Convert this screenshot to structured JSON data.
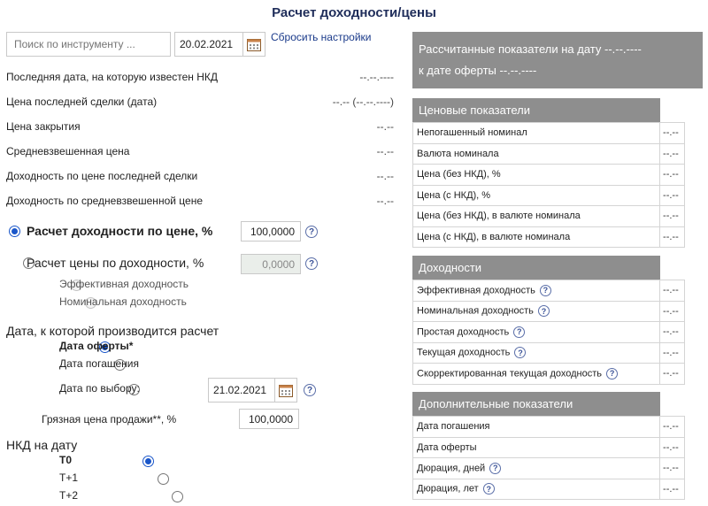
{
  "page": {
    "title": "Расчет доходности/цены"
  },
  "toolbar": {
    "search_placeholder": "Поиск по инструменту ...",
    "date": "20.02.2021",
    "reset_label": "Сбросить настройки"
  },
  "info": {
    "rows": [
      {
        "label": "Последняя дата, на которую известен НКД",
        "value": "--.--.----"
      },
      {
        "label": "Цена последней сделки (дата)",
        "value": "--.-- (--.--.----)"
      },
      {
        "label": "Цена закрытия",
        "value": "--.--"
      },
      {
        "label": "Средневзвешенная цена",
        "value": "--.--"
      },
      {
        "label": "Доходность по цене последней сделки",
        "value": "--.--"
      },
      {
        "label": "Доходность по средневзвешенной цене",
        "value": "--.--"
      }
    ]
  },
  "calc": {
    "by_price_label": "Расчет доходности по цене, %",
    "by_price_value": "100,0000",
    "by_yield_label": "Расчет цены по доходности, %",
    "by_yield_value": "0,0000",
    "yield_options": [
      "Эффективная доходность",
      "Номинальная доходность"
    ]
  },
  "calc_date": {
    "label": "Дата, к которой производится расчет",
    "options": [
      "Дата оферты*",
      "Дата погашения",
      "Дата по выбору:"
    ],
    "custom_date": "21.02.2021",
    "dirty_price_label": "Грязная цена продажи**, %",
    "dirty_price_value": "100,0000"
  },
  "nkd": {
    "label": "НКД на дату",
    "options": [
      "Т0",
      "Т+1",
      "Т+2"
    ]
  },
  "right": {
    "header_line1": "Рассчитанные показатели на дату --.--.----",
    "header_line2": "к дате оферты --.--.----",
    "price_section": {
      "title": "Ценовые показатели",
      "rows": [
        {
          "label": "Непогашенный номинал",
          "value": "--.--"
        },
        {
          "label": "Валюта номинала",
          "value": "--.--"
        },
        {
          "label": "Цена (без НКД), %",
          "value": "--.--"
        },
        {
          "label": "Цена (с НКД), %",
          "value": "--.--"
        },
        {
          "label": "Цена (без НКД), в валюте номинала",
          "value": "--.--"
        },
        {
          "label": "Цена (с НКД), в валюте номинала",
          "value": "--.--"
        }
      ]
    },
    "yield_section": {
      "title": "Доходности",
      "rows": [
        {
          "label": "Эффективная доходность",
          "value": "--.--"
        },
        {
          "label": "Номинальная доходность",
          "value": "--.--"
        },
        {
          "label": "Простая доходность",
          "value": "--.--"
        },
        {
          "label": "Текущая доходность",
          "value": "--.--"
        },
        {
          "label": "Скорректированная текущая доходность",
          "value": "--.--"
        }
      ]
    },
    "extra_section": {
      "title": "Дополнительные показатели",
      "rows": [
        {
          "label": "Дата погашения",
          "value": "--.--"
        },
        {
          "label": "Дата оферты",
          "value": "--.--"
        },
        {
          "label": "Дюрация, дней",
          "value": "--.--"
        },
        {
          "label": "Дюрация, лет",
          "value": "--.--"
        }
      ]
    }
  },
  "colors": {
    "accent": "#1a56c9",
    "header_bg": "#8e8e8e",
    "title": "#1f2d5a"
  }
}
